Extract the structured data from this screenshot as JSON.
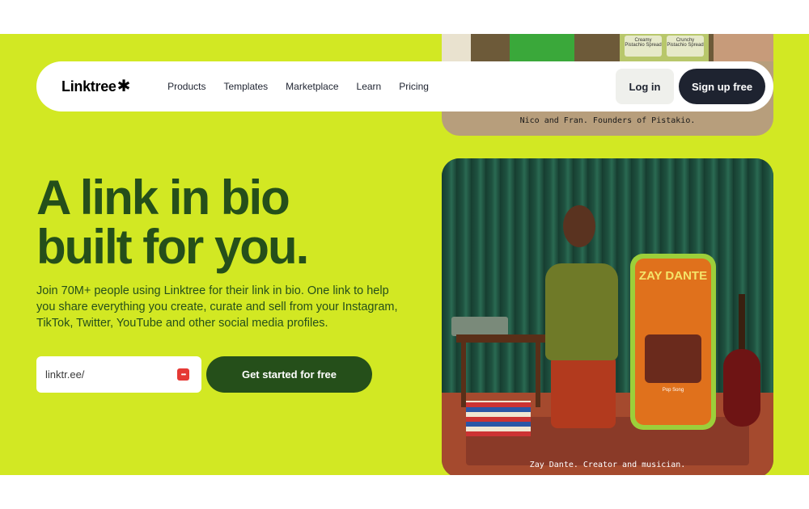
{
  "brand": {
    "name": "Linktree",
    "logo_glyph": "✱"
  },
  "nav": {
    "links": [
      "Products",
      "Templates",
      "Marketplace",
      "Learn",
      "Pricing"
    ],
    "login_label": "Log in",
    "signup_label": "Sign up free"
  },
  "hero": {
    "headline_line1": "A link in bio",
    "headline_line2": "built for you.",
    "subtext": "Join 70M+ people using Linktree for their link in bio. One link to help you share everything you create, curate and sell from your Instagram, TikTok, Twitter, YouTube and other social media profiles.",
    "url_prefix": "linktr.ee/",
    "cta_label": "Get started for free"
  },
  "top_photo": {
    "caption": "Nico and Fran. Founders of Pistakio.",
    "tile_texts": [
      "Creamy Pistachio Spread",
      "Crunchy Pistachio Spread"
    ]
  },
  "main_photo": {
    "caption": "Zay Dante. Creator and musician.",
    "phone_title": "ZAY DANTE",
    "phone_song": "Pop Song"
  },
  "colors": {
    "background_lime": "#d2e823",
    "dark_green": "#254f1a",
    "navy": "#1e2330",
    "password_icon": "#e53935"
  },
  "icons": [
    "asterisk-logo-icon",
    "password-manager-icon"
  ]
}
